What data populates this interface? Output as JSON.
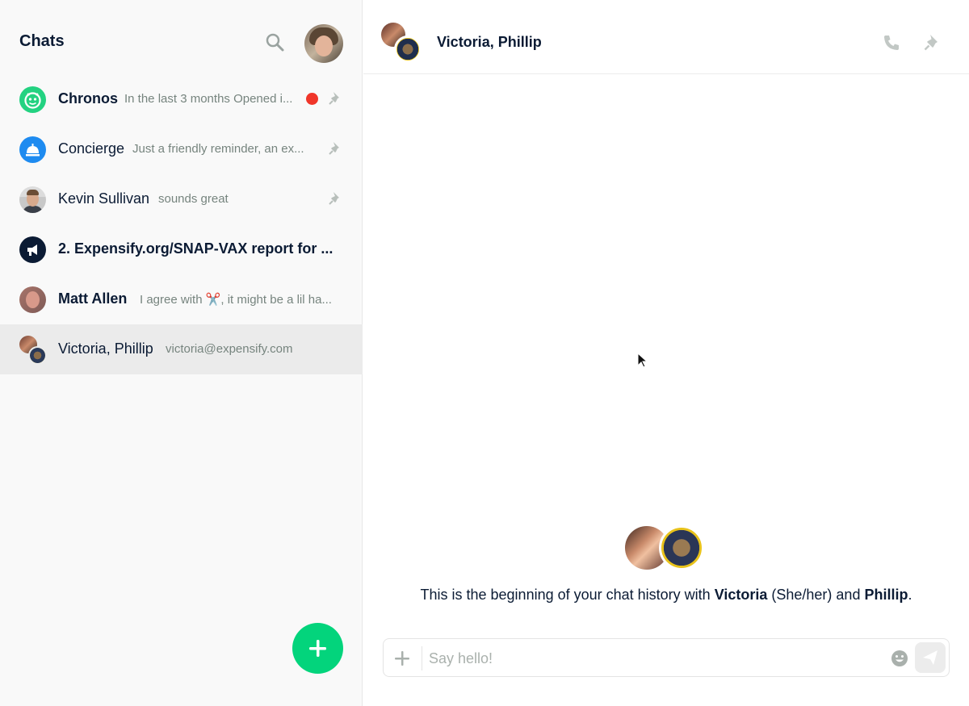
{
  "sidebar": {
    "title": "Chats",
    "chats": [
      {
        "name": "Chronos",
        "preview": "In the last 3 months Opened i...",
        "bold": true,
        "pinned": true,
        "unread": true
      },
      {
        "name": "Concierge",
        "preview": "Just a friendly reminder, an ex...",
        "bold": false,
        "pinned": true
      },
      {
        "name": "Kevin Sullivan",
        "preview": "sounds great",
        "bold": false,
        "pinned": true
      },
      {
        "name": "2. Expensify.org/SNAP-VAX report for ...",
        "preview": "",
        "bold": true
      },
      {
        "name": "Matt Allen",
        "preview": "I agree with ✂️, it might be a lil ha...",
        "bold": true
      },
      {
        "name": "Victoria, Phillip",
        "preview": "victoria@expensify.com",
        "bold": false,
        "active": true
      }
    ]
  },
  "header": {
    "title": "Victoria, Phillip"
  },
  "intro": {
    "prefix": "This is the beginning of your chat history with ",
    "name1": "Victoria",
    "pronouns": " (She/her) and ",
    "name2": "Phillip",
    "suffix": "."
  },
  "composer": {
    "placeholder": "Say hello!",
    "value": ""
  },
  "colors": {
    "accent": "#03d47c",
    "unread": "#f0362a",
    "concierge": "#1e8bf0",
    "text": "#0b1b34",
    "muted": "#76847e"
  }
}
